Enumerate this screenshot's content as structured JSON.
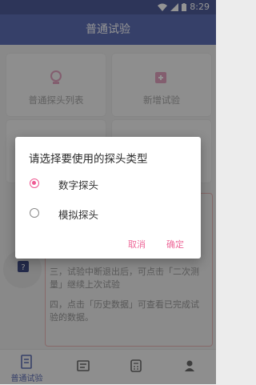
{
  "status_bar": {
    "time": "8:29"
  },
  "app_bar": {
    "title": "普通试验"
  },
  "cards": [
    {
      "label": "普通探头列表",
      "icon": "probe-icon"
    },
    {
      "label": "新增试验",
      "icon": "add-icon"
    },
    {
      "label": "",
      "icon": "refresh-icon"
    },
    {
      "label": "",
      "icon": "info-icon"
    }
  ],
  "info": {
    "line3": "三，试验中断退出后，可点击「二次测量」继续上次试验",
    "line4": "四，点击「历史数据」可查看已完成试验的数据。"
  },
  "bottom_nav": {
    "items": [
      {
        "label": "普通试验",
        "icon": "document-icon"
      },
      {
        "label": "",
        "icon": "history-icon"
      },
      {
        "label": "",
        "icon": "calculator-icon"
      },
      {
        "label": "",
        "icon": "person-icon"
      }
    ]
  },
  "dialog": {
    "title": "请选择要使用的探头类型",
    "options": [
      {
        "label": "数字探头",
        "selected": true
      },
      {
        "label": "模拟探头",
        "selected": false
      }
    ],
    "cancel": "取消",
    "confirm": "确定"
  },
  "colors": {
    "primary": "#5e6eb6",
    "accent": "#ee5a93"
  }
}
